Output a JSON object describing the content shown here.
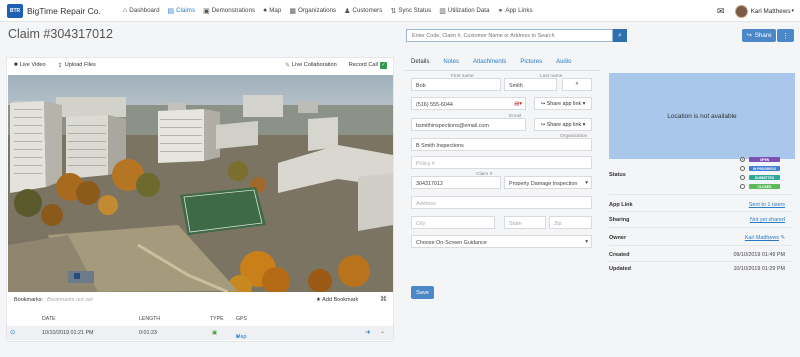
{
  "nav": {
    "logo_text": "BTR",
    "brand": "BigTime Repair Co.",
    "items": [
      {
        "label": "Dashboard",
        "icon": "dashboard-icon"
      },
      {
        "label": "Claims",
        "icon": "claims-icon"
      },
      {
        "label": "Demonstrations",
        "icon": "demonstrations-icon"
      },
      {
        "label": "Map",
        "icon": "map-marker-icon"
      },
      {
        "label": "Organizations",
        "icon": "building-icon"
      },
      {
        "label": "Customers",
        "icon": "user-icon"
      },
      {
        "label": "Sync Status",
        "icon": "sync-icon"
      },
      {
        "label": "Utilization Data",
        "icon": "chart-icon"
      },
      {
        "label": "App Links",
        "icon": "link-icon"
      }
    ],
    "active_item": "Claims",
    "user_name": "Karl Matthews"
  },
  "header": {
    "title": "Claim #304317012",
    "search_placeholder": "Enter Code, Claim #, Customer Name or Address to Search",
    "share_label": "Share",
    "more_label": "⋮"
  },
  "video_panel": {
    "live_video": "Live Video",
    "upload_files": "Upload Files",
    "live_collaboration": "Live Collaboration",
    "record_call": "Record Call",
    "bookmarks_label": "Bookmarks:",
    "bookmarks_placeholder": "Bookmarks not set",
    "add_bookmark": "Add Bookmark",
    "columns": [
      "DATE",
      "LENGTH",
      "TYPE",
      "GPS"
    ],
    "rows": [
      {
        "date": "10/10/2019 01:21 PM",
        "length": "0:01:23",
        "gps": "Map"
      }
    ]
  },
  "tabs": [
    "Details",
    "Notes",
    "Attachments",
    "Pictures",
    "Audio"
  ],
  "active_tab": "Details",
  "form": {
    "first_name_label": "First name",
    "first_name": "Bob",
    "last_name_label": "Last name",
    "last_name": "Smith",
    "phone": "(516) 555-6044",
    "share_app_link": "Share app link",
    "email_label": "Email",
    "email": "bsmithinspections@email.com",
    "organization_label": "Organization",
    "organization": "B Smith Inspections",
    "policy_placeholder": "Policy #",
    "claim_label": "Claim #",
    "claim": "304317012",
    "claim_type": "Property Damage Inspection",
    "address_placeholder": "Address",
    "city_placeholder": "City",
    "state_placeholder": "State",
    "zip_placeholder": "Zip",
    "guidance": "Choose On-Screen Guidance",
    "save": "Save"
  },
  "info": {
    "location_text": "Location is not available",
    "status_label": "Status",
    "statuses": [
      {
        "text": "OPEN",
        "color": "#7b52b4",
        "selected": true
      },
      {
        "text": "IN PROGRESS",
        "color": "#3f7fd6",
        "selected": false
      },
      {
        "text": "SUBMITTED",
        "color": "#2fa89a",
        "selected": false
      },
      {
        "text": "CLOSED",
        "color": "#5bbb5b",
        "selected": false
      }
    ],
    "app_link_label": "App Link",
    "app_link_value": "Sent to 1 users",
    "sharing_label": "Sharing",
    "sharing_value": "Not yet shared",
    "owner_label": "Owner",
    "owner_value": "Karl Matthews",
    "created_label": "Created",
    "created_value": "09/10/2019 01:49 PM",
    "updated_label": "Updated",
    "updated_value": "10/10/2019 01:29 PM"
  },
  "colors": {
    "accent": "#2a7cc7",
    "button": "#4a88c7",
    "map_placeholder": "#a9c7ea"
  }
}
